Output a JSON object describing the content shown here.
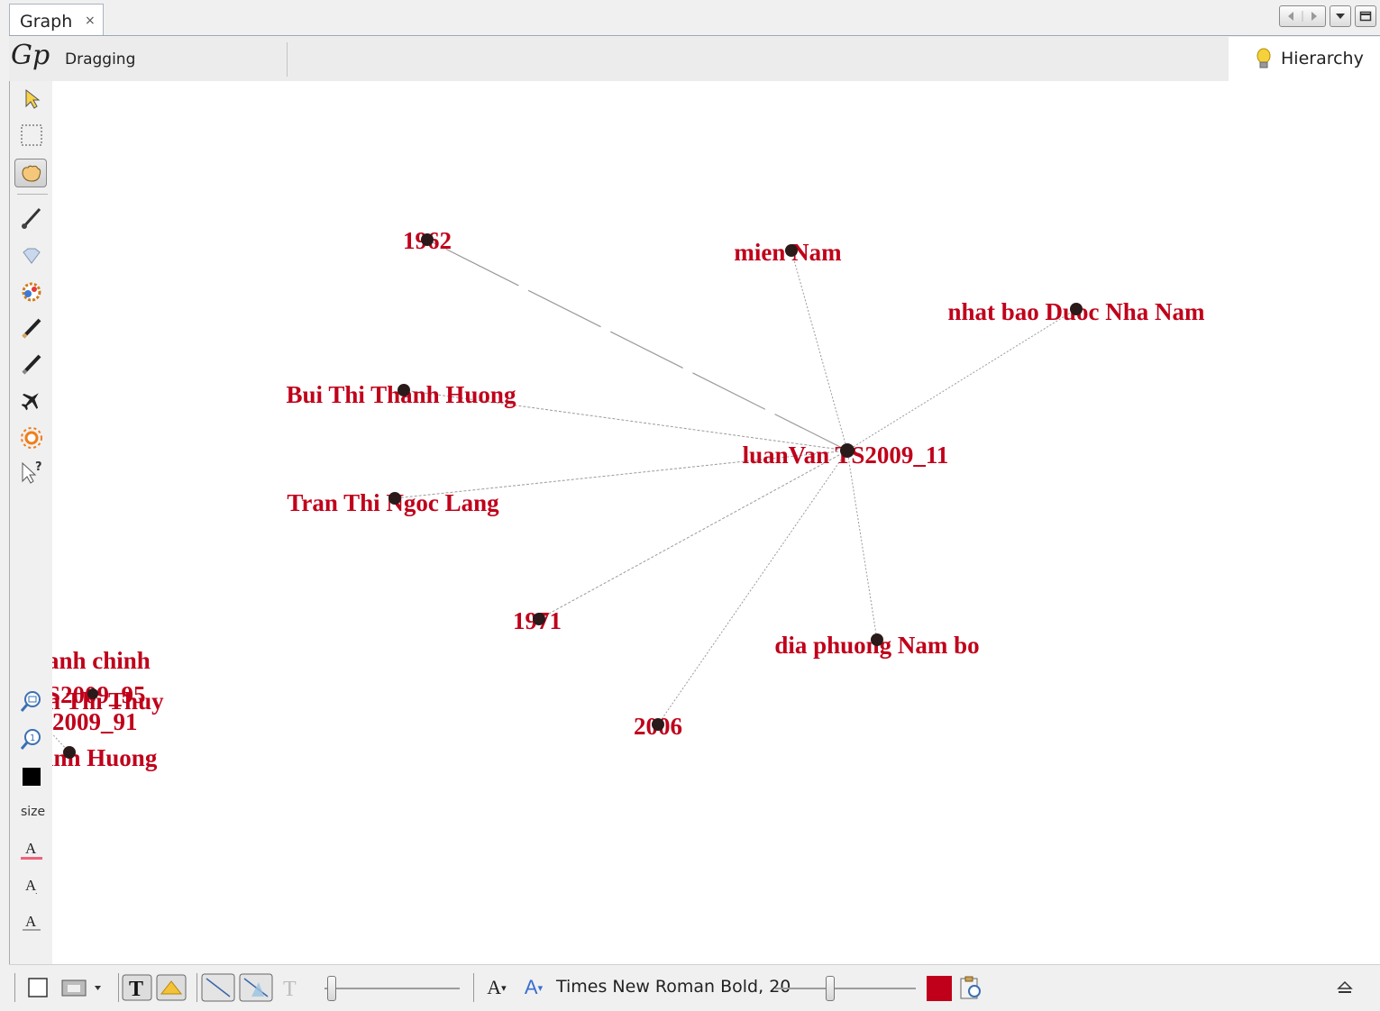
{
  "tab": {
    "title": "Graph",
    "close": "×"
  },
  "toolbar": {
    "mode_label": "Dragging",
    "logo": "Gp",
    "hierarchy_label": "Hierarchy"
  },
  "left_toolbar": {
    "size_label": "size",
    "tools": [
      "arrow-select-icon",
      "rect-select-icon",
      "drag-hand-icon",
      "brush-icon",
      "diamond-icon",
      "color-burst-icon",
      "pencil-icon",
      "edge-pencil-icon",
      "airplane-icon",
      "sun-icon",
      "cursor-help-icon",
      "zoom-fit-icon",
      "zoom-reset-icon",
      "background-color-icon",
      "label-color-icon",
      "label-size-icon",
      "label-font-icon"
    ]
  },
  "graph": {
    "center": {
      "label": "luanVan TS2009_11"
    },
    "nodes": [
      {
        "label": "1962"
      },
      {
        "label": "mien Nam"
      },
      {
        "label": "nhat bao Duoc Nha Nam"
      },
      {
        "label": "Bui Thi Thanh Huong"
      },
      {
        "label": "Tran Thi Ngoc Lang"
      },
      {
        "label": "1971"
      },
      {
        "label": "dia phuong Nam bo"
      },
      {
        "label": "2006"
      }
    ],
    "offscreen_labels": [
      {
        "label": "anh chinh"
      },
      {
        "label": "S2009_95"
      },
      {
        "label": "en Thi Thuy"
      },
      {
        "label": "2009_91"
      },
      {
        "label": "inh Huong"
      }
    ],
    "colors": {
      "label": "#c0001a",
      "node": "#2a1a1a",
      "edge": "#9a9a9a"
    }
  },
  "bottom_toolbar": {
    "font_label": "Times New Roman Bold, 20",
    "label_color": "#c0001a",
    "font_size_down": "A",
    "font_size_up": "A"
  }
}
